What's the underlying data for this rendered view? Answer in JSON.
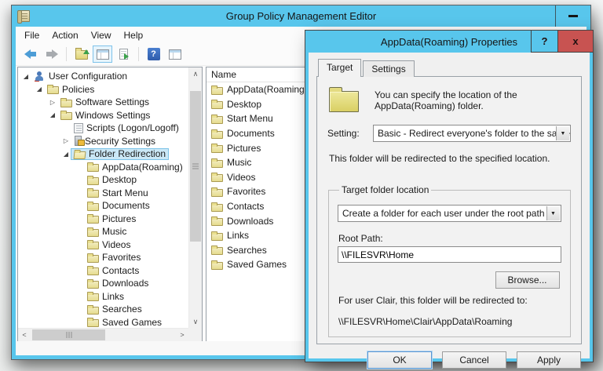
{
  "window": {
    "title": "Group Policy Management Editor",
    "menu_items": [
      "File",
      "Action",
      "View",
      "Help"
    ],
    "toolbar_icons": [
      "back-icon",
      "forward-icon",
      "up-one-level-folder-icon",
      "show-console-tree-icon",
      "export-list-icon",
      "help-icon",
      "new-window-icon"
    ]
  },
  "tree": {
    "items": [
      {
        "label": "User Configuration",
        "cls": "lvl-0",
        "arrow": "◢",
        "icon": "icon-user"
      },
      {
        "label": "Policies",
        "cls": "lvl-1",
        "arrow": "◢",
        "icon": "icon-folder"
      },
      {
        "label": "Software Settings",
        "cls": "lvl-2",
        "arrow": "▷",
        "icon": "icon-folder"
      },
      {
        "label": "Windows Settings",
        "cls": "lvl-2",
        "arrow": "◢",
        "icon": "icon-folder"
      },
      {
        "label": "Scripts (Logon/Logoff)",
        "cls": "lvl-3",
        "arrow": "",
        "icon": "icon-script"
      },
      {
        "label": "Security Settings",
        "cls": "lvl-3",
        "arrow": "▷",
        "icon": "icon-security"
      },
      {
        "label": "Folder Redirection",
        "cls": "lvl-3 selected",
        "arrow": "◢",
        "icon": "icon-folder-open"
      },
      {
        "label": "AppData(Roaming)",
        "cls": "lvl-4",
        "arrow": "",
        "icon": "icon-folder"
      },
      {
        "label": "Desktop",
        "cls": "lvl-4",
        "arrow": "",
        "icon": "icon-folder"
      },
      {
        "label": "Start Menu",
        "cls": "lvl-4",
        "arrow": "",
        "icon": "icon-folder"
      },
      {
        "label": "Documents",
        "cls": "lvl-4",
        "arrow": "",
        "icon": "icon-folder"
      },
      {
        "label": "Pictures",
        "cls": "lvl-4",
        "arrow": "",
        "icon": "icon-folder"
      },
      {
        "label": "Music",
        "cls": "lvl-4",
        "arrow": "",
        "icon": "icon-folder"
      },
      {
        "label": "Videos",
        "cls": "lvl-4",
        "arrow": "",
        "icon": "icon-folder"
      },
      {
        "label": "Favorites",
        "cls": "lvl-4",
        "arrow": "",
        "icon": "icon-folder"
      },
      {
        "label": "Contacts",
        "cls": "lvl-4",
        "arrow": "",
        "icon": "icon-folder"
      },
      {
        "label": "Downloads",
        "cls": "lvl-4",
        "arrow": "",
        "icon": "icon-folder"
      },
      {
        "label": "Links",
        "cls": "lvl-4",
        "arrow": "",
        "icon": "icon-folder"
      },
      {
        "label": "Searches",
        "cls": "lvl-4",
        "arrow": "",
        "icon": "icon-folder"
      },
      {
        "label": "Saved Games",
        "cls": "lvl-4",
        "arrow": "",
        "icon": "icon-folder"
      }
    ]
  },
  "list": {
    "header": "Name",
    "items": [
      "AppData(Roaming)",
      "Desktop",
      "Start Menu",
      "Documents",
      "Pictures",
      "Music",
      "Videos",
      "Favorites",
      "Contacts",
      "Downloads",
      "Links",
      "Searches",
      "Saved Games"
    ]
  },
  "dialog": {
    "title": "AppData(Roaming) Properties",
    "help_glyph": "?",
    "close_glyph": "x",
    "tabs": [
      {
        "label": "Target",
        "cls": "active"
      },
      {
        "label": "Settings",
        "cls": ""
      }
    ],
    "intro": "You can specify the location of the AppData(Roaming) folder.",
    "setting_label": "Setting:",
    "setting_value": "Basic - Redirect everyone's folder to the same location",
    "redirect_note": "This folder will be redirected to the specified location.",
    "group_title": "Target folder location",
    "location_value": "Create a folder for each user under the root path",
    "root_path_label": "Root Path:",
    "root_path_value": "\\\\FILESVR\\Home",
    "browse_label": "Browse...",
    "preview_label": "For user Clair, this folder will be redirected to:",
    "preview_path": "\\\\FILESVR\\Home\\Clair\\AppData\\Roaming",
    "ok_label": "OK",
    "cancel_label": "Cancel",
    "apply_label": "Apply"
  }
}
